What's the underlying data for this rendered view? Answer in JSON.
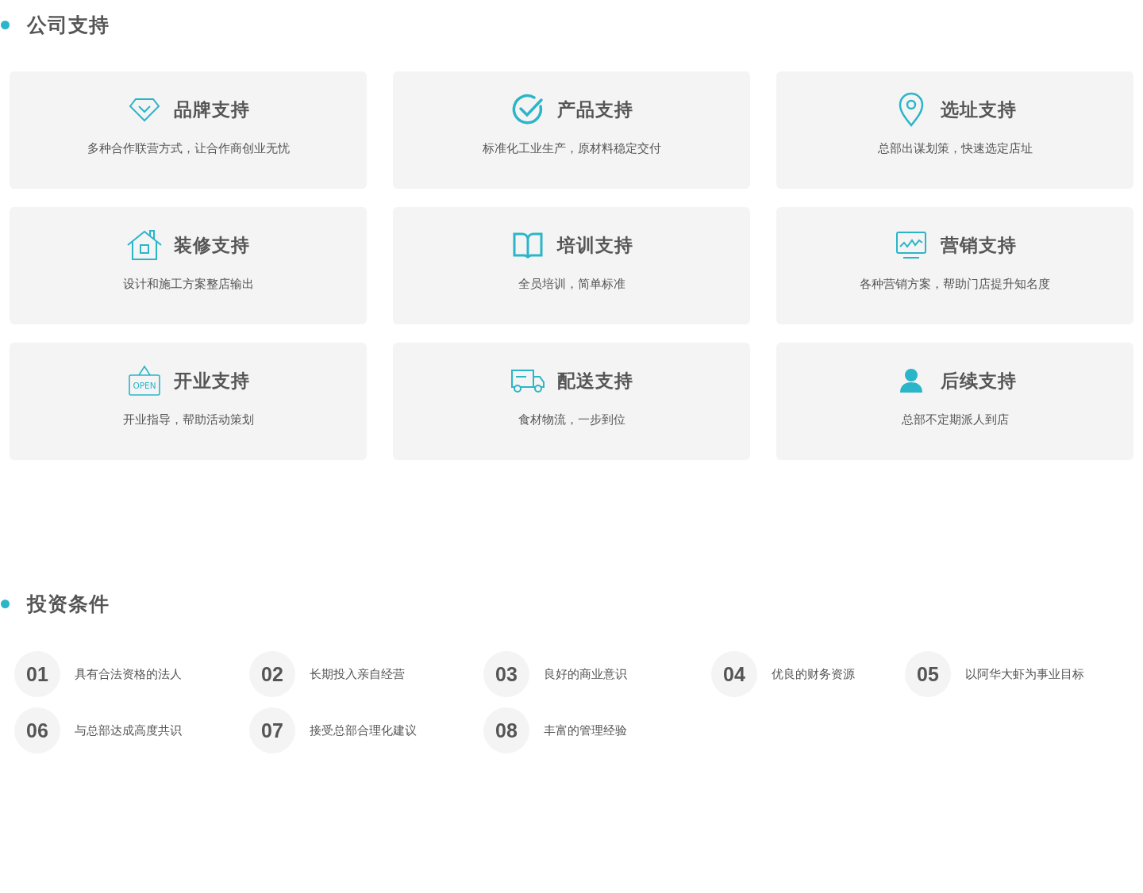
{
  "support": {
    "title": "公司支持",
    "cards": [
      {
        "kind": "diamond",
        "title": "品牌支持",
        "desc": "多种合作联营方式，让合作商创业无忧"
      },
      {
        "kind": "check",
        "title": "产品支持",
        "desc": "标准化工业生产，原材料稳定交付"
      },
      {
        "kind": "pin",
        "title": "选址支持",
        "desc": "总部出谋划策，快速选定店址"
      },
      {
        "kind": "house",
        "title": "装修支持",
        "desc": "设计和施工方案整店输出"
      },
      {
        "kind": "book",
        "title": "培训支持",
        "desc": "全员培训，简单标准"
      },
      {
        "kind": "monitor",
        "title": "营销支持",
        "desc": "各种营销方案，帮助门店提升知名度"
      },
      {
        "kind": "sign",
        "title": "开业支持",
        "desc": "开业指导，帮助活动策划",
        "sign_text": "OPEN"
      },
      {
        "kind": "truck",
        "title": "配送支持",
        "desc": "食材物流，一步到位"
      },
      {
        "kind": "person",
        "title": "后续支持",
        "desc": "总部不定期派人到店"
      }
    ]
  },
  "conditions": {
    "title": "投资条件",
    "items": [
      {
        "number": "01",
        "text": "具有合法资格的法人"
      },
      {
        "number": "02",
        "text": "长期投入亲自经营"
      },
      {
        "number": "03",
        "text": "良好的商业意识"
      },
      {
        "number": "04",
        "text": "优良的财务资源"
      },
      {
        "number": "05",
        "text": "以阿华大虾为事业目标"
      },
      {
        "number": "06",
        "text": "与总部达成高度共识"
      },
      {
        "number": "07",
        "text": "接受总部合理化建议"
      },
      {
        "number": "08",
        "text": "丰富的管理经验"
      }
    ]
  }
}
